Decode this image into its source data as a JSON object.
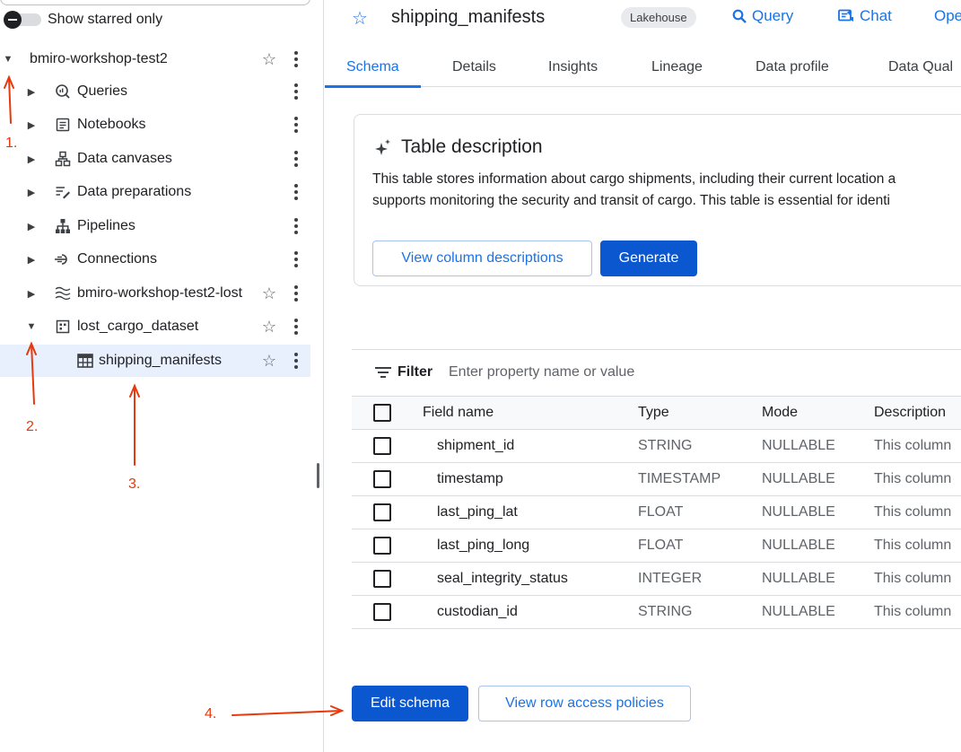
{
  "sidebar": {
    "starred_toggle_label": "Show starred only",
    "items": [
      {
        "label": "bmiro-workshop-test2",
        "icon": "project-icon",
        "caret": "expanded"
      },
      {
        "label": "Queries",
        "icon": "query-icon",
        "caret": "collapsed"
      },
      {
        "label": "Notebooks",
        "icon": "notebook-icon",
        "caret": "collapsed"
      },
      {
        "label": "Data canvases",
        "icon": "canvas-icon",
        "caret": "collapsed"
      },
      {
        "label": "Data preparations",
        "icon": "data-prep-icon",
        "caret": "collapsed"
      },
      {
        "label": "Pipelines",
        "icon": "pipeline-icon",
        "caret": "collapsed"
      },
      {
        "label": "Connections",
        "icon": "connection-icon",
        "caret": "collapsed"
      },
      {
        "label": "bmiro-workshop-test2-lost",
        "icon": "lakehouse-icon",
        "caret": "collapsed"
      },
      {
        "label": "lost_cargo_dataset",
        "icon": "dataset-icon",
        "caret": "expanded"
      },
      {
        "label": "shipping_manifests",
        "icon": "table-icon",
        "caret": "none",
        "selected": true
      }
    ]
  },
  "annotations": [
    "1.",
    "2.",
    "3.",
    "4."
  ],
  "header": {
    "title": "shipping_manifests",
    "chip": "Lakehouse",
    "actions": {
      "query": "Query",
      "chat": "Chat",
      "open": "Ope"
    }
  },
  "tabs": [
    "Schema",
    "Details",
    "Insights",
    "Lineage",
    "Data profile",
    "Data Qual"
  ],
  "description": {
    "heading": "Table description",
    "line1": "This table stores information about cargo shipments, including their current location a",
    "line2": "supports monitoring the security and transit of cargo. This table is essential for identi",
    "view_button": "View column descriptions",
    "generate_button": "Generate"
  },
  "filter": {
    "label": "Filter",
    "placeholder": "Enter property name or value"
  },
  "schema": {
    "headers": [
      "Field name",
      "Type",
      "Mode",
      "Description"
    ],
    "rows": [
      {
        "name": "shipment_id",
        "type": "STRING",
        "mode": "NULLABLE",
        "desc": "This column"
      },
      {
        "name": "timestamp",
        "type": "TIMESTAMP",
        "mode": "NULLABLE",
        "desc": "This column"
      },
      {
        "name": "last_ping_lat",
        "type": "FLOAT",
        "mode": "NULLABLE",
        "desc": "This column"
      },
      {
        "name": "last_ping_long",
        "type": "FLOAT",
        "mode": "NULLABLE",
        "desc": "This column"
      },
      {
        "name": "seal_integrity_status",
        "type": "INTEGER",
        "mode": "NULLABLE",
        "desc": "This column"
      },
      {
        "name": "custodian_id",
        "type": "STRING",
        "mode": "NULLABLE",
        "desc": "This column"
      }
    ]
  },
  "buttons": {
    "edit_schema": "Edit schema",
    "row_access": "View row access policies"
  },
  "colors": {
    "accent": "#1a73e8",
    "primary_button": "#0b57d0",
    "annotation": "#e8380d",
    "selected_row": "#e8f0fe"
  }
}
